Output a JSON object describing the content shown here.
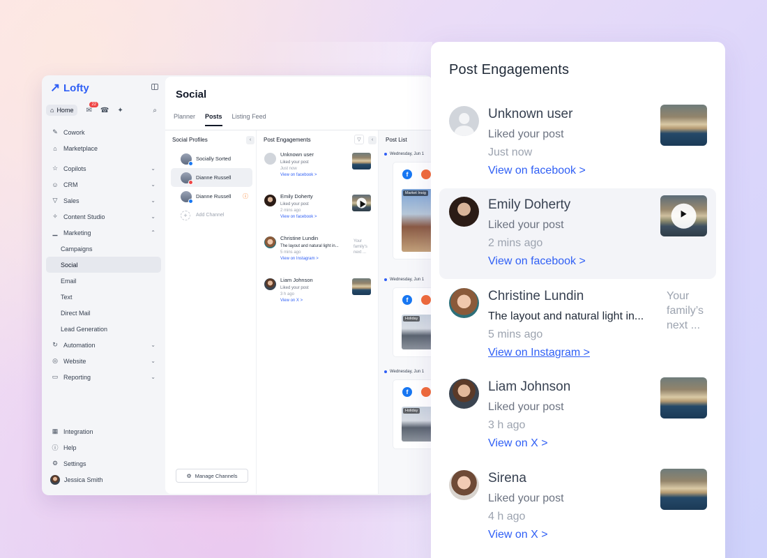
{
  "brand": {
    "name": "Lofty"
  },
  "sidebar": {
    "home_label": "Home",
    "notification_count": "22",
    "items": [
      {
        "label": "Cowork",
        "icon": "cowork-icon"
      },
      {
        "label": "Marketplace",
        "icon": "store-icon"
      }
    ],
    "groups": [
      {
        "label": "Copilots",
        "icon": "star-icon"
      },
      {
        "label": "CRM",
        "icon": "people-icon"
      },
      {
        "label": "Sales",
        "icon": "funnel-icon"
      },
      {
        "label": "Content Studio",
        "icon": "wand-icon"
      },
      {
        "label": "Marketing",
        "icon": "chart-icon"
      }
    ],
    "marketing_sub": [
      "Campaigns",
      "Social",
      "Email",
      "Text",
      "Direct Mail",
      "Lead Generation"
    ],
    "groups2": [
      {
        "label": "Automation",
        "icon": "repeat-icon"
      },
      {
        "label": "Website",
        "icon": "globe-icon"
      },
      {
        "label": "Reporting",
        "icon": "monitor-icon"
      }
    ],
    "bottom": [
      {
        "label": "Integration",
        "icon": "grid-icon"
      },
      {
        "label": "Help",
        "icon": "help-icon"
      },
      {
        "label": "Settings",
        "icon": "gear-icon"
      }
    ],
    "user_name": "Jessica Smith"
  },
  "main": {
    "title": "Social",
    "tabs": [
      "Planner",
      "Posts",
      "Listing Feed"
    ],
    "active_tab": "Posts"
  },
  "profiles": {
    "header": "Social Profiles",
    "items": [
      "Socially Sorted",
      "Dianne Russell",
      "Dianne Russell"
    ],
    "add_label": "Add Channel",
    "manage_label": "Manage Channels"
  },
  "engagements": {
    "header": "Post Engagements",
    "items": [
      {
        "name": "Unknown user",
        "action": "Liked your post",
        "time": "Just now",
        "link": "View on facebook >"
      },
      {
        "name": "Emily Doherty",
        "action": "Liked your post",
        "time": "2 mins ago",
        "link": "View on facebook >"
      },
      {
        "name": "Christine Lundin",
        "action": "The layout and natural light in...",
        "time": "5 mins ago",
        "link": "View on Instagram >",
        "snippet": "Your family's next ..."
      },
      {
        "name": "Liam Johnson",
        "action": "Liked your post",
        "time": "3 h ago",
        "link": "View on X >"
      }
    ]
  },
  "post_list": {
    "header": "Post List",
    "dates": [
      "Wednesday, Jun 1",
      "Wednesday, Jun 1",
      "Wednesday, Jun 1"
    ],
    "tags": [
      "Market Insig",
      "Holiday",
      "Holiday"
    ]
  },
  "panel": {
    "title": "Post Engagements",
    "items": [
      {
        "name": "Unknown user",
        "action": "Liked your post",
        "time": "Just now",
        "link": "View on facebook >"
      },
      {
        "name": "Emily Doherty",
        "action": "Liked your post",
        "time": "2 mins ago",
        "link": "View on facebook >"
      },
      {
        "name": "Christine Lundin",
        "action": "The layout and natural light in...",
        "time": "5 mins ago",
        "link": "View on Instagram >",
        "snippet": "Your family’s next ..."
      },
      {
        "name": "Liam Johnson",
        "action": "Liked your post",
        "time": "3 h ago",
        "link": "View on X >"
      },
      {
        "name": "Sirena",
        "action": "Liked your post",
        "time": "4 h ago",
        "link": "View on X >"
      }
    ]
  },
  "colors": {
    "accent": "#2f5ff5",
    "badge": "#ef4444"
  }
}
